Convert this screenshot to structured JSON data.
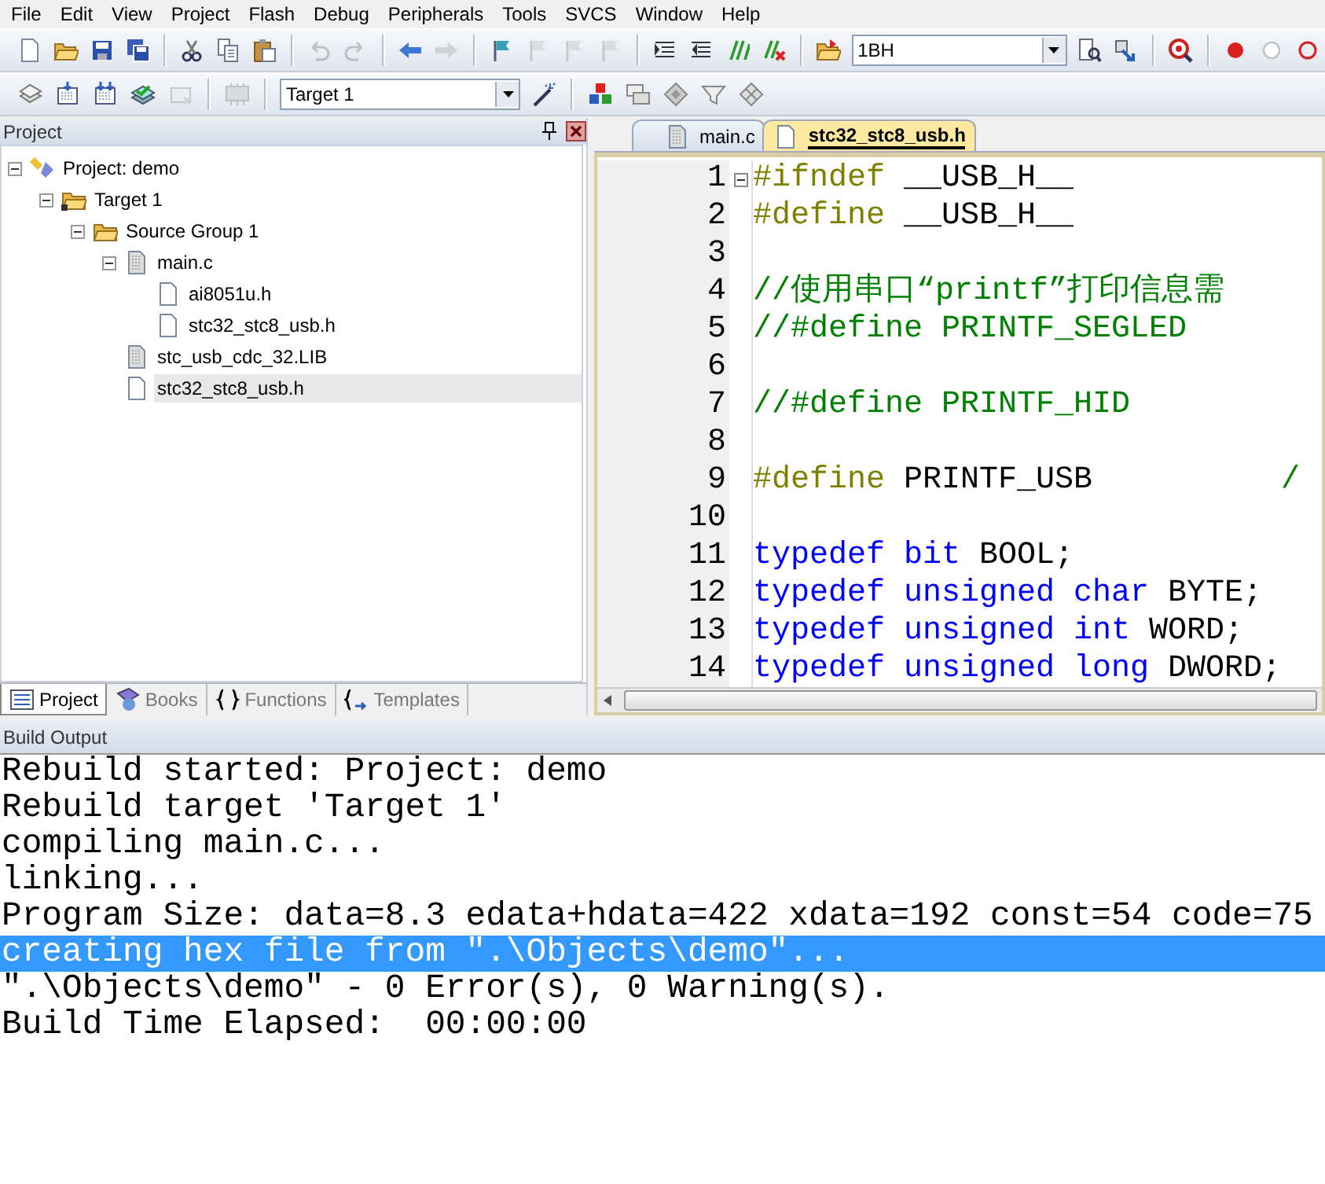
{
  "menu": [
    "File",
    "Edit",
    "View",
    "Project",
    "Flash",
    "Debug",
    "Peripherals",
    "Tools",
    "SVCS",
    "Window",
    "Help"
  ],
  "toolbar_1": [
    {
      "kind": "button",
      "disabled": false
    },
    {
      "kind": "button",
      "disabled": false
    },
    {
      "kind": "button",
      "disabled": false
    },
    {
      "kind": "button",
      "disabled": false
    },
    {
      "kind": "separator"
    },
    {
      "kind": "button",
      "disabled": false
    },
    {
      "kind": "button",
      "disabled": false
    },
    {
      "kind": "button",
      "disabled": false
    },
    {
      "kind": "separator"
    },
    {
      "kind": "button",
      "disabled": true
    },
    {
      "kind": "button",
      "disabled": true
    },
    {
      "kind": "separator"
    },
    {
      "kind": "button",
      "disabled": false
    },
    {
      "kind": "button",
      "disabled": true
    },
    {
      "kind": "separator"
    },
    {
      "kind": "button",
      "disabled": false
    },
    {
      "kind": "button",
      "disabled": true
    },
    {
      "kind": "button",
      "disabled": true
    },
    {
      "kind": "button",
      "disabled": true
    },
    {
      "kind": "separator"
    },
    {
      "kind": "button",
      "disabled": false
    },
    {
      "kind": "button",
      "disabled": false
    },
    {
      "kind": "button",
      "disabled": false
    },
    {
      "kind": "button",
      "disabled": false
    },
    {
      "kind": "separator"
    },
    {
      "kind": "button",
      "disabled": false
    },
    {
      "kind": "combo",
      "value": "1BH"
    },
    {
      "kind": "button",
      "disabled": false
    },
    {
      "kind": "button",
      "disabled": false
    },
    {
      "kind": "separator"
    },
    {
      "kind": "button",
      "disabled": false
    },
    {
      "kind": "separator"
    },
    {
      "kind": "button",
      "disabled": false
    },
    {
      "kind": "button",
      "disabled": false
    },
    {
      "kind": "button",
      "disabled": false
    }
  ],
  "toolbar_2": [
    {
      "kind": "button",
      "disabled": false
    },
    {
      "kind": "button",
      "disabled": false
    },
    {
      "kind": "button",
      "disabled": false
    },
    {
      "kind": "button",
      "disabled": false
    },
    {
      "kind": "button",
      "disabled": true
    },
    {
      "kind": "separator"
    },
    {
      "kind": "button",
      "disabled": true
    },
    {
      "kind": "separator"
    },
    {
      "kind": "combo",
      "value": "Target 1"
    },
    {
      "kind": "button",
      "disabled": false
    },
    {
      "kind": "separator"
    },
    {
      "kind": "button",
      "disabled": false
    },
    {
      "kind": "button",
      "disabled": false
    },
    {
      "kind": "button",
      "disabled": false
    },
    {
      "kind": "button",
      "disabled": false
    },
    {
      "kind": "button",
      "disabled": false
    }
  ],
  "project_panel": {
    "title": "Project",
    "tree": [
      {
        "label": "Project: demo",
        "kind": "project",
        "expanded": true,
        "selected": false,
        "children": [
          {
            "label": "Target 1",
            "kind": "target",
            "expanded": true,
            "selected": false,
            "children": [
              {
                "label": "Source Group 1",
                "kind": "group",
                "expanded": true,
                "selected": false,
                "children": [
                  {
                    "label": "main.c",
                    "kind": "source",
                    "expanded": true,
                    "selected": false,
                    "children": [
                      {
                        "label": "ai8051u.h",
                        "kind": "header",
                        "selected": false
                      },
                      {
                        "label": "stc32_stc8_usb.h",
                        "kind": "header",
                        "selected": false
                      }
                    ]
                  },
                  {
                    "label": "stc_usb_cdc_32.LIB",
                    "kind": "source",
                    "selected": false
                  },
                  {
                    "label": "stc32_stc8_usb.h",
                    "kind": "header",
                    "selected": true
                  }
                ]
              }
            ]
          }
        ]
      }
    ],
    "tabs": [
      {
        "label": "Project",
        "selected": true
      },
      {
        "label": "Books",
        "selected": false
      },
      {
        "label": "Functions",
        "selected": false
      },
      {
        "label": "Templates",
        "selected": false
      }
    ]
  },
  "editor": {
    "tabs": [
      {
        "label": "main.c",
        "selected": false
      },
      {
        "label": "stc32_stc8_usb.h",
        "selected": true
      }
    ],
    "lines": [
      {
        "number": "1",
        "folded": false,
        "tokens": [
          {
            "kind": "directive",
            "text": "#ifndef"
          },
          {
            "kind": "plain",
            "text": "__USB_H__"
          }
        ]
      },
      {
        "number": "2",
        "tokens": [
          {
            "kind": "directive",
            "text": "#define"
          },
          {
            "kind": "plain",
            "text": "__USB_H__"
          }
        ]
      },
      {
        "number": "3"
      },
      {
        "number": "4",
        "tokens": [
          {
            "kind": "comment",
            "text": "//使用串口“printf”打印信息需"
          }
        ]
      },
      {
        "number": "5",
        "tokens": [
          {
            "kind": "comment",
            "text": "//#define PRINTF_SEGLED"
          }
        ]
      },
      {
        "number": "6"
      },
      {
        "number": "7",
        "tokens": [
          {
            "kind": "comment",
            "text": "//#define PRINTF_HID"
          }
        ]
      },
      {
        "number": "8"
      },
      {
        "number": "9",
        "tokens": [
          {
            "kind": "directive",
            "text": "#define"
          },
          {
            "kind": "plain",
            "text": "PRINTF_USB"
          },
          {
            "kind": "trailing_comment",
            "text": "/"
          }
        ]
      },
      {
        "number": "10"
      },
      {
        "number": "11",
        "tokens": [
          {
            "kind": "keyword",
            "text": "typedef"
          },
          {
            "kind": "keyword",
            "text": "bit"
          },
          {
            "kind": "plain",
            "text": "BOOL;"
          }
        ]
      },
      {
        "number": "12",
        "tokens": [
          {
            "kind": "keyword",
            "text": "typedef"
          },
          {
            "kind": "keyword",
            "text": "unsigned"
          },
          {
            "kind": "keyword",
            "text": "char"
          },
          {
            "kind": "plain",
            "text": "BYTE;"
          }
        ]
      },
      {
        "number": "13",
        "tokens": [
          {
            "kind": "keyword",
            "text": "typedef"
          },
          {
            "kind": "keyword",
            "text": "unsigned"
          },
          {
            "kind": "keyword",
            "text": "int"
          },
          {
            "kind": "plain",
            "text": "WORD;"
          }
        ]
      },
      {
        "number": "14",
        "tokens": [
          {
            "kind": "keyword",
            "text": "typedef"
          },
          {
            "kind": "keyword",
            "text": "unsigned"
          },
          {
            "kind": "keyword",
            "text": "long"
          },
          {
            "kind": "plain",
            "text": "DWORD;"
          }
        ]
      }
    ]
  },
  "build_output": {
    "title": "Build Output",
    "lines": [
      {
        "text": "Rebuild started: Project: demo",
        "selected": false
      },
      {
        "text": "Rebuild target 'Target 1'",
        "selected": false
      },
      {
        "text": "compiling main.c...",
        "selected": false
      },
      {
        "text": "linking...",
        "selected": false
      },
      {
        "text": "Program Size: data=8.3 edata+hdata=422 xdata=192 const=54 code=75",
        "selected": false
      },
      {
        "text": "creating hex file from \".\\Objects\\demo\"...",
        "selected": true
      },
      {
        "text": "\".\\Objects\\demo\" - 0 Error(s), 0 Warning(s).",
        "selected": false
      },
      {
        "text": "Build Time Elapsed:  00:00:00",
        "selected": false
      }
    ]
  }
}
